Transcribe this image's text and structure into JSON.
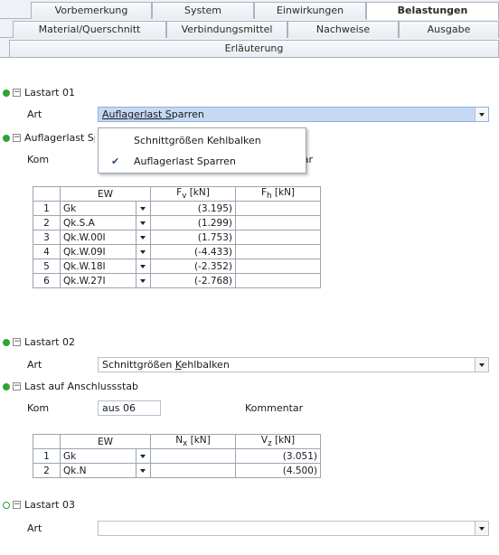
{
  "tabs_row1": [
    "Vorbemerkung",
    "System",
    "Einwirkungen",
    "Belastungen"
  ],
  "tabs_row2": [
    "Material/Querschnitt",
    "Verbindungsmittel",
    "Nachweise",
    "Ausgabe"
  ],
  "tabs_row3": [
    "Erläuterung"
  ],
  "active_tab": "Belastungen",
  "lastart1": {
    "header": "Lastart 01",
    "art_label": "Art",
    "art_value": "Auflagerlast Sparren"
  },
  "dropdown": {
    "options": [
      "Schnittgrößen Kehlbalken",
      "Auflagerlast Sparren"
    ],
    "checked": "Auflagerlast Sparren"
  },
  "section1": {
    "header": "Auflagerlast Sparren",
    "kom_label": "Kom",
    "kommentar_label": "Kommentar"
  },
  "table1": {
    "headers": [
      "EW",
      "F_v [kN]",
      "F_h [kN]"
    ],
    "rows": [
      {
        "idx": "1",
        "ew": "Gk",
        "fv": "(3.195)",
        "fh": ""
      },
      {
        "idx": "2",
        "ew": "Qk.S.A",
        "fv": "(1.299)",
        "fh": ""
      },
      {
        "idx": "3",
        "ew": "Qk.W.00I",
        "fv": "(1.753)",
        "fh": ""
      },
      {
        "idx": "4",
        "ew": "Qk.W.09I",
        "fv": "(-4.433)",
        "fh": ""
      },
      {
        "idx": "5",
        "ew": "Qk.W.18I",
        "fv": "(-2.352)",
        "fh": ""
      },
      {
        "idx": "6",
        "ew": "Qk.W.27I",
        "fv": "(-2.768)",
        "fh": ""
      }
    ]
  },
  "lastart2": {
    "header": "Lastart 02",
    "art_label": "Art",
    "art_value": "Schnittgrößen Kehlbalken"
  },
  "section2": {
    "header": "Last auf Anschlussstab",
    "kom_label": "Kom",
    "kom_value": "aus 06",
    "kommentar_label": "Kommentar"
  },
  "table2": {
    "headers": [
      "EW",
      "N_x [kN]",
      "V_z [kN]"
    ],
    "rows": [
      {
        "idx": "1",
        "ew": "Gk",
        "nx": "",
        "vz": "(3.051)"
      },
      {
        "idx": "2",
        "ew": "Qk.N",
        "nx": "",
        "vz": "(4.500)"
      }
    ]
  },
  "lastart3": {
    "header": "Lastart 03",
    "art_label": "Art",
    "art_value": ""
  },
  "colors": {
    "accent_green": "#2fa33c",
    "selection_blue": "#c5d9f4"
  }
}
